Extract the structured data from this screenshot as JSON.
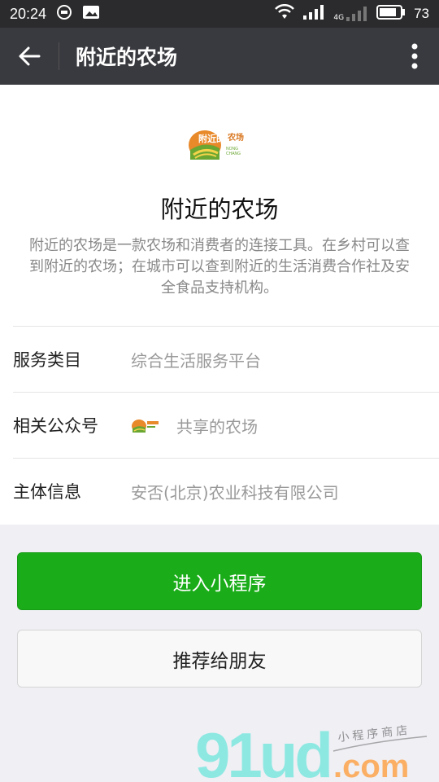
{
  "status_bar": {
    "time": "20:24",
    "battery": "73",
    "network": "4G"
  },
  "nav": {
    "title": "附近的农场"
  },
  "app": {
    "name": "附近的农场",
    "description": "附近的农场是一款农场和消费者的连接工具。在乡村可以查到附近的农场；在城市可以查到附近的生活消费合作社及安全食品支持机构。",
    "logo_text": "附近的农场",
    "logo_subtext": "NONG CHANG"
  },
  "info": [
    {
      "label": "服务类目",
      "value": "综合生活服务平台"
    },
    {
      "label": "相关公众号",
      "value": "共享的农场"
    },
    {
      "label": "主体信息",
      "value": "安否(北京)农业科技有限公司"
    }
  ],
  "buttons": {
    "enter": "进入小程序",
    "recommend": "推荐给朋友"
  },
  "watermark": {
    "brand": "91ud",
    "domain": ".com",
    "tagline": "小程序商店"
  },
  "colors": {
    "primary_green": "#1aad19",
    "navbar": "#393a3f",
    "statusbar": "#2b2b2d"
  },
  "icons": [
    "back-arrow-icon",
    "more-vertical-icon",
    "wifi-icon",
    "signal-icon",
    "battery-icon"
  ]
}
